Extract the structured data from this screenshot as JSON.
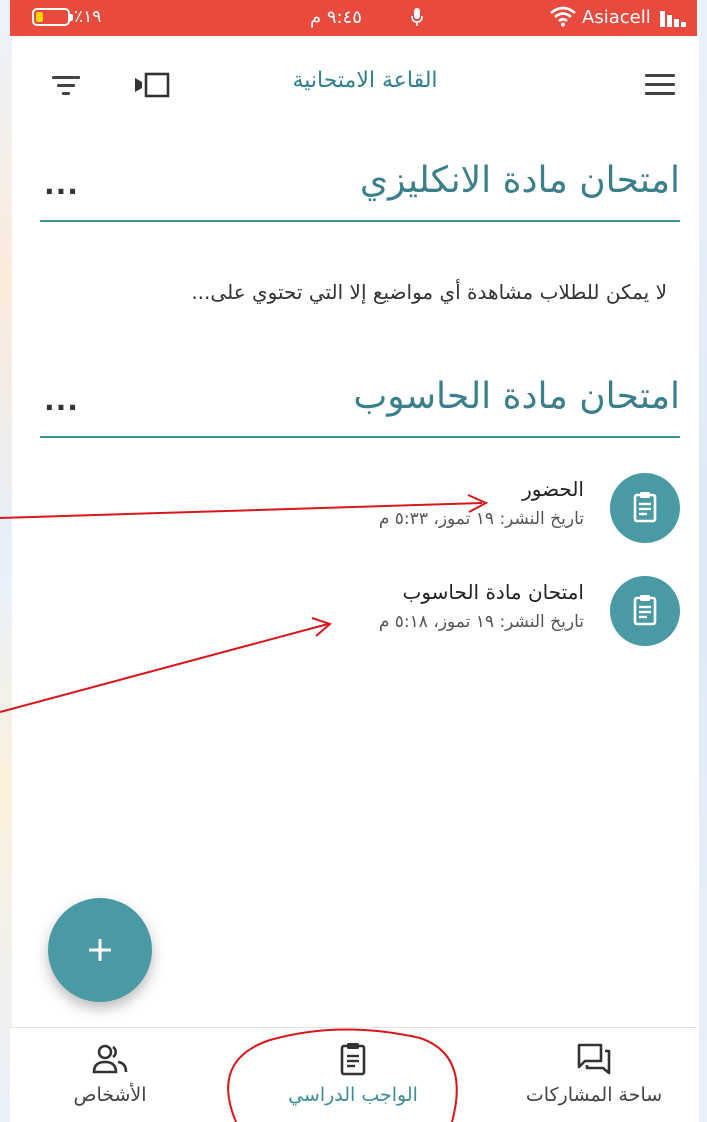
{
  "status_bar": {
    "battery_percent": "٪١٩",
    "time": "٩:٤٥ م",
    "carrier": "Asiacell"
  },
  "app_bar": {
    "title": "القاعة الامتحانية"
  },
  "sections": [
    {
      "title": "امتحان مادة الانكليزي",
      "more_label": "...",
      "description": "لا يمكن للطلاب مشاهدة أي مواضيع إلا التي تحتوي على..."
    },
    {
      "title": "امتحان مادة الحاسوب",
      "more_label": "...",
      "items": [
        {
          "title": "الحضور",
          "meta": "تاريخ النشر: ١٩ تموز، ٥:٣٣ م",
          "icon": "assignment-icon"
        },
        {
          "title": "امتحان مادة الحاسوب",
          "meta": "تاريخ النشر: ١٩ تموز، ٥:١٨ م",
          "icon": "assignment-icon"
        }
      ]
    }
  ],
  "fab": {
    "label": "+"
  },
  "bottom_nav": {
    "active": "classwork",
    "items": [
      {
        "key": "people",
        "label": "الأشخاص",
        "icon": "people-icon"
      },
      {
        "key": "classwork",
        "label": "الواجب الدراسي",
        "icon": "assignment-icon"
      },
      {
        "key": "stream",
        "label": "ساحة المشاركات",
        "icon": "forum-icon"
      }
    ]
  },
  "colors": {
    "status_bar": "#e84b3e",
    "accent": "#4a9aa6",
    "title_teal": "#3b7f8c",
    "annotation_red": "#d8161b"
  }
}
